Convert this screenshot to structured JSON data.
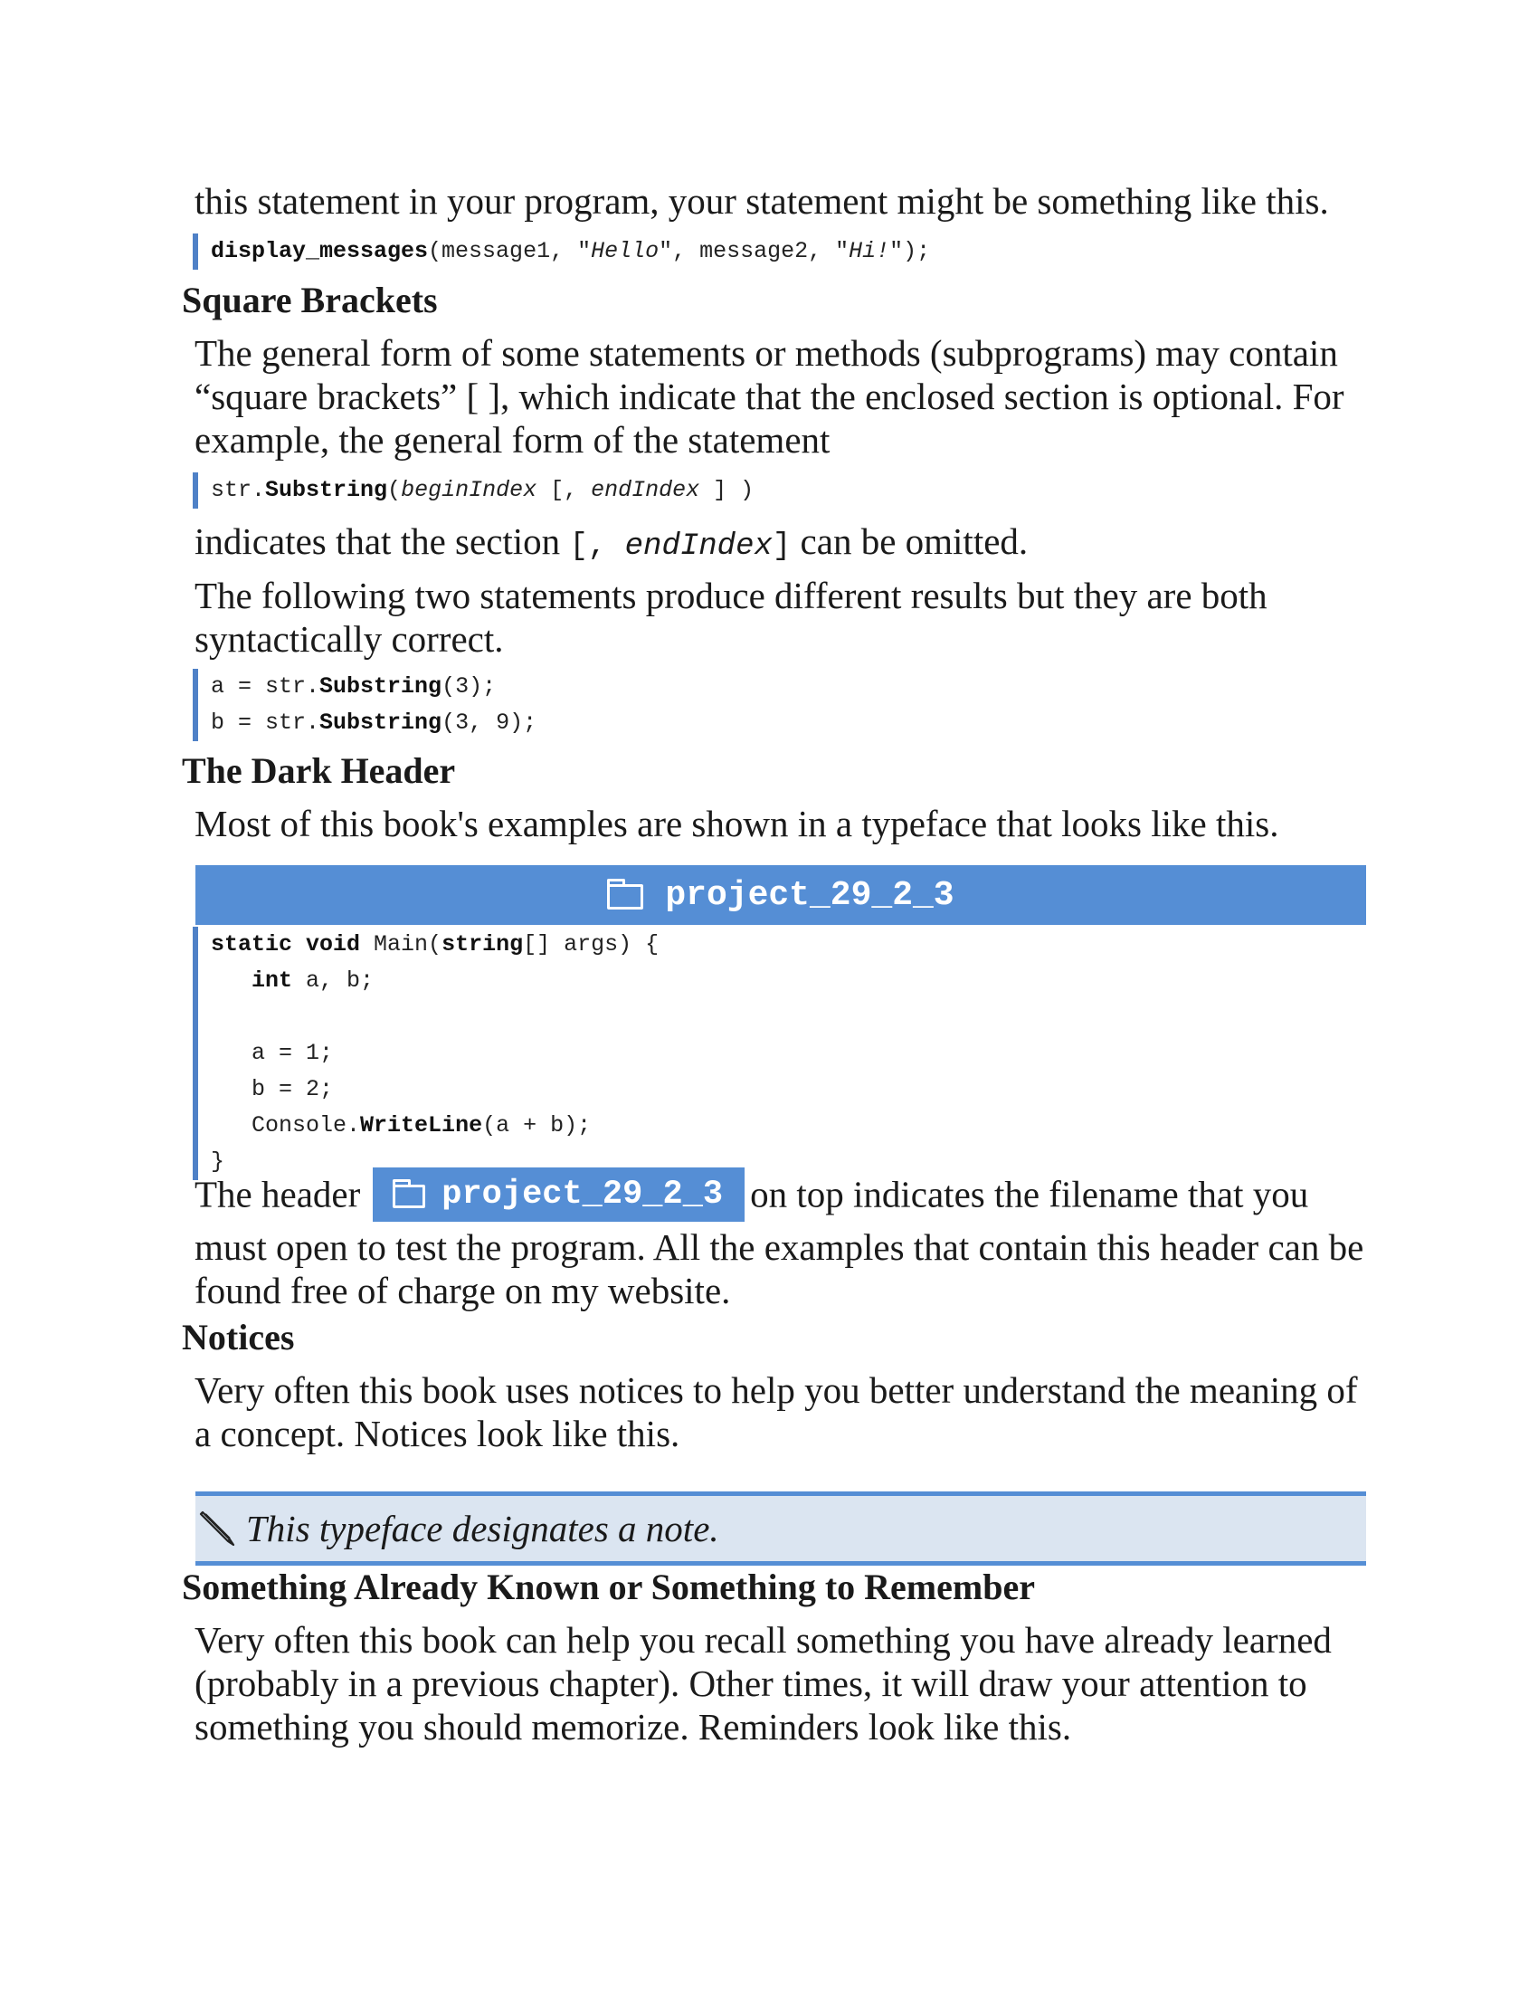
{
  "intro_line": "this statement in your program, your statement might be something like this.",
  "code1": {
    "fn": "display_messages",
    "p1": "(message1, \"",
    "s1": "Hello",
    "p2": "\", message2, \"",
    "s2": "Hi!",
    "p3": "\");"
  },
  "square_brackets": {
    "heading": "Square Brackets",
    "para1": "The general form of some statements or methods (subprograms) may contain “square brackets” [ ], which indicate that the enclosed section is optional. For example, the general form of the statement",
    "code": {
      "a": "str.",
      "b": "Substring",
      "c": "(",
      "d": "beginIndex",
      "e": " [, ",
      "f": "endIndex",
      "g": " ] )"
    },
    "para2_before": "indicates that the section ",
    "para2_code_a": "[, ",
    "para2_code_b": "endIndex",
    "para2_code_c": "]",
    "para2_after": " can be omitted.",
    "para3": "The following two statements produce different results but they are both syntactically correct.",
    "code2_line1": {
      "a": "a = str.",
      "b": "Substring",
      "c": "(3);"
    },
    "code2_line2": {
      "a": "b = str.",
      "b": "Substring",
      "c": "(3, 9);"
    }
  },
  "dark_header": {
    "heading": "The Dark Header",
    "para1": "Most of this book's examples are shown in a typeface that looks like this.",
    "filename": "project_29_2_3",
    "code": {
      "l1_kw1": "static",
      "l1_sp1": " ",
      "l1_kw2": "void",
      "l1_t1": " Main(",
      "l1_kw3": "string",
      "l1_t2": "[] args) {",
      "l2_kw": "int",
      "l2_t": " a, b;",
      "l4": "a = 1;",
      "l5": "b = 2;",
      "l6_a": "Console.",
      "l6_b": "WriteLine",
      "l6_c": "(a + b);",
      "l7": "}"
    },
    "para2_before": "The header",
    "para2_after": "on top indicates the filename that you must open to test the program. All the examples that contain this header can be found free of charge on my website."
  },
  "notices": {
    "heading": "Notices",
    "para": "Very often this book uses notices to help you better understand the meaning of a concept. Notices look like this.",
    "note_text": "This typeface designates a note.",
    "note_icon": "pencil-icon"
  },
  "remember": {
    "heading": "Something Already Known or Something to Remember",
    "para": "Very often this book can help you recall something you have already learned (probably in a previous chapter). Other times, it will draw your attention to something you should memorize. Reminders look like this."
  },
  "colors": {
    "accent_blue": "#558ed5",
    "note_bg": "#dbe5f1"
  }
}
